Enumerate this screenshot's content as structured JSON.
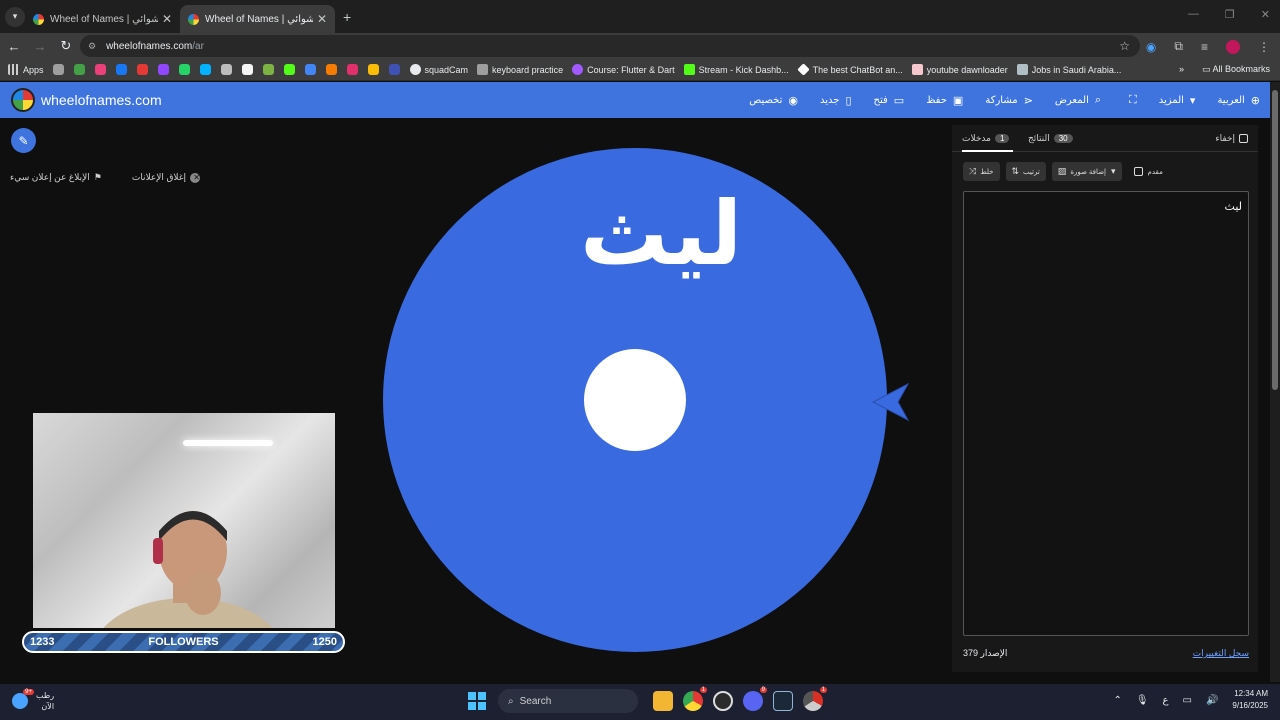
{
  "browser": {
    "tabs": [
      {
        "label": "Wheel of Names | اسم العشوائي",
        "active": false
      },
      {
        "label": "Wheel of Names | اسم العشوائي",
        "active": true
      }
    ],
    "new_tab_label": "+",
    "window_controls": [
      "—",
      "❐",
      "✕"
    ],
    "url_host": "wheelofnames.com",
    "url_path": "/ar",
    "bookmarks": [
      {
        "label": "squadCam",
        "color": "#e8eaed"
      },
      {
        "label": "keyboard practice",
        "color": "#9e9e9e"
      },
      {
        "label": "Course: Flutter & Dart",
        "color": "#a259ff"
      },
      {
        "label": "Stream - Kick Dashb...",
        "color": "#53fc18"
      },
      {
        "label": "The best ChatBot an...",
        "color": "#ffffff"
      },
      {
        "label": "youtube dawnloader",
        "color": "#f5c6cb"
      },
      {
        "label": "Jobs in Saudi Arabia...",
        "color": "#1e88e5"
      }
    ],
    "apps_label": "Apps",
    "all_bookmarks_label": "All Bookmarks"
  },
  "site": {
    "title": "wheelofnames.com",
    "nav": [
      {
        "label": "العربية",
        "icon": "globe-icon",
        "glyph": "⊕"
      },
      {
        "label": "المزيد",
        "icon": "chevron-down-icon",
        "glyph": "▾"
      },
      {
        "label": "",
        "icon": "fullscreen-icon",
        "glyph": "⛶"
      },
      {
        "label": "المعرض",
        "icon": "search-icon",
        "glyph": "⌕"
      },
      {
        "label": "مشاركة",
        "icon": "share-icon",
        "glyph": "⋖"
      },
      {
        "label": "حفظ",
        "icon": "save-icon",
        "glyph": "▣"
      },
      {
        "label": "فتح",
        "icon": "folder-icon",
        "glyph": "▭"
      },
      {
        "label": "جديد",
        "icon": "new-file-icon",
        "glyph": "▯"
      },
      {
        "label": "تخصيص",
        "icon": "palette-icon",
        "glyph": "◉"
      }
    ],
    "close_ads_label": "إغلاق الإعلانات",
    "report_ad_label": "الإبلاغ عن إعلان سيء",
    "wheel": {
      "entry_label": "ليث",
      "color": "#3a6ae0",
      "pointer_color": "#3a6ae0"
    },
    "overlay": {
      "followers_label": "FOLLOWERS",
      "followers_current": "1233",
      "followers_goal": "1250",
      "progress_fraction": 0.0
    },
    "sidebar": {
      "hide_label": "إخفاء",
      "entries_tab_label": "مدخلات",
      "entries_count": "1",
      "results_tab_label": "النتائج",
      "results_count": "30",
      "shuffle_label": "خلط",
      "sort_label": "ترتيب",
      "add_image_label": "إضافة صورة",
      "advanced_label": "مقدم",
      "entries_text": "ليث",
      "version_label": "الإصدار 379",
      "changelog_label": "سجل التغييرات"
    }
  },
  "taskbar": {
    "weather_line1": "رطب",
    "weather_line2": "الآن",
    "weather_badge": "9+",
    "search_label": "Search",
    "lang_label": "ع",
    "time": "12:34 AM",
    "date": "9/16/2025",
    "apps": [
      {
        "name": "file-explorer-icon",
        "color": "#f2b632",
        "badge": ""
      },
      {
        "name": "chrome-icon",
        "color": "#34a853",
        "badge": "1"
      },
      {
        "name": "obs-icon",
        "color": "#2b2b2b",
        "badge": ""
      },
      {
        "name": "discord-icon",
        "color": "#5865f2",
        "badge": "9"
      },
      {
        "name": "steam-icon",
        "color": "#1b2838",
        "badge": ""
      },
      {
        "name": "chrome-alt-icon",
        "color": "#d93025",
        "badge": "1"
      }
    ]
  }
}
